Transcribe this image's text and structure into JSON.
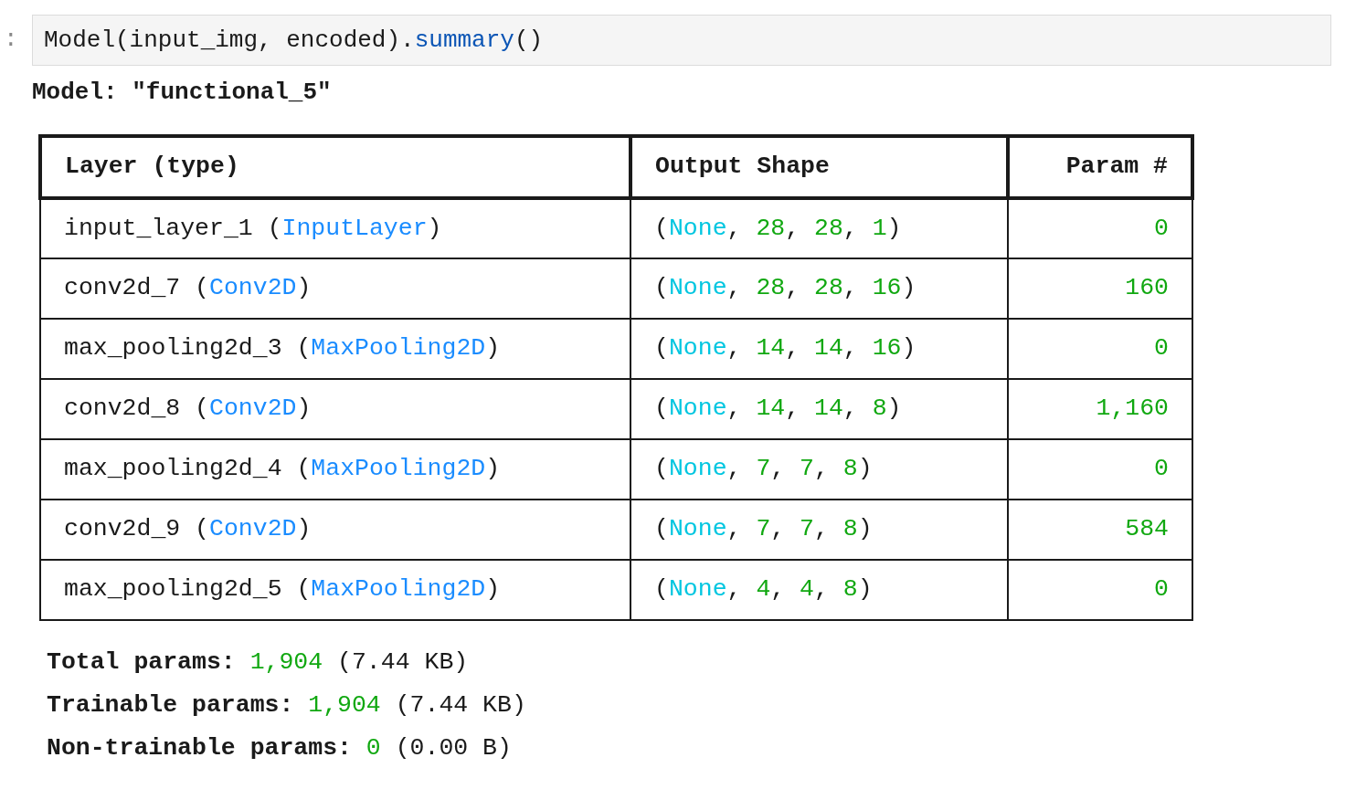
{
  "cell": {
    "prompt": ":",
    "code": [
      {
        "kind": "plain",
        "text": "Model(input_img, encoded)."
      },
      {
        "kind": "method",
        "text": "summary"
      },
      {
        "kind": "plain",
        "text": "()"
      }
    ]
  },
  "output": {
    "model_title": "Model: \"functional_5\"",
    "table": {
      "columns": [
        {
          "label": "Layer (type)",
          "kind": "text"
        },
        {
          "label": "Output Shape",
          "kind": "text"
        },
        {
          "label": "Param #",
          "kind": "number"
        }
      ],
      "rows": [
        {
          "layer": [
            {
              "kind": "plain",
              "text": "input_layer_1 ("
            },
            {
              "kind": "type",
              "text": "InputLayer"
            },
            {
              "kind": "plain",
              "text": ")"
            }
          ],
          "shape": [
            {
              "kind": "plain",
              "text": "("
            },
            {
              "kind": "none",
              "text": "None"
            },
            {
              "kind": "plain",
              "text": ", "
            },
            {
              "kind": "num",
              "text": "28"
            },
            {
              "kind": "plain",
              "text": ", "
            },
            {
              "kind": "num",
              "text": "28"
            },
            {
              "kind": "plain",
              "text": ", "
            },
            {
              "kind": "num",
              "text": "1"
            },
            {
              "kind": "plain",
              "text": ")"
            }
          ],
          "params": "0"
        },
        {
          "layer": [
            {
              "kind": "plain",
              "text": "conv2d_7 ("
            },
            {
              "kind": "type",
              "text": "Conv2D"
            },
            {
              "kind": "plain",
              "text": ")"
            }
          ],
          "shape": [
            {
              "kind": "plain",
              "text": "("
            },
            {
              "kind": "none",
              "text": "None"
            },
            {
              "kind": "plain",
              "text": ", "
            },
            {
              "kind": "num",
              "text": "28"
            },
            {
              "kind": "plain",
              "text": ", "
            },
            {
              "kind": "num",
              "text": "28"
            },
            {
              "kind": "plain",
              "text": ", "
            },
            {
              "kind": "num",
              "text": "16"
            },
            {
              "kind": "plain",
              "text": ")"
            }
          ],
          "params": "160"
        },
        {
          "layer": [
            {
              "kind": "plain",
              "text": "max_pooling2d_3 ("
            },
            {
              "kind": "type",
              "text": "MaxPooling2D"
            },
            {
              "kind": "plain",
              "text": ")"
            }
          ],
          "shape": [
            {
              "kind": "plain",
              "text": "("
            },
            {
              "kind": "none",
              "text": "None"
            },
            {
              "kind": "plain",
              "text": ", "
            },
            {
              "kind": "num",
              "text": "14"
            },
            {
              "kind": "plain",
              "text": ", "
            },
            {
              "kind": "num",
              "text": "14"
            },
            {
              "kind": "plain",
              "text": ", "
            },
            {
              "kind": "num",
              "text": "16"
            },
            {
              "kind": "plain",
              "text": ")"
            }
          ],
          "params": "0"
        },
        {
          "layer": [
            {
              "kind": "plain",
              "text": "conv2d_8 ("
            },
            {
              "kind": "type",
              "text": "Conv2D"
            },
            {
              "kind": "plain",
              "text": ")"
            }
          ],
          "shape": [
            {
              "kind": "plain",
              "text": "("
            },
            {
              "kind": "none",
              "text": "None"
            },
            {
              "kind": "plain",
              "text": ", "
            },
            {
              "kind": "num",
              "text": "14"
            },
            {
              "kind": "plain",
              "text": ", "
            },
            {
              "kind": "num",
              "text": "14"
            },
            {
              "kind": "plain",
              "text": ", "
            },
            {
              "kind": "num",
              "text": "8"
            },
            {
              "kind": "plain",
              "text": ")"
            }
          ],
          "params": "1,160"
        },
        {
          "layer": [
            {
              "kind": "plain",
              "text": "max_pooling2d_4 ("
            },
            {
              "kind": "type",
              "text": "MaxPooling2D"
            },
            {
              "kind": "plain",
              "text": ")"
            }
          ],
          "shape": [
            {
              "kind": "plain",
              "text": "("
            },
            {
              "kind": "none",
              "text": "None"
            },
            {
              "kind": "plain",
              "text": ", "
            },
            {
              "kind": "num",
              "text": "7"
            },
            {
              "kind": "plain",
              "text": ", "
            },
            {
              "kind": "num",
              "text": "7"
            },
            {
              "kind": "plain",
              "text": ", "
            },
            {
              "kind": "num",
              "text": "8"
            },
            {
              "kind": "plain",
              "text": ")"
            }
          ],
          "params": "0"
        },
        {
          "layer": [
            {
              "kind": "plain",
              "text": "conv2d_9 ("
            },
            {
              "kind": "type",
              "text": "Conv2D"
            },
            {
              "kind": "plain",
              "text": ")"
            }
          ],
          "shape": [
            {
              "kind": "plain",
              "text": "("
            },
            {
              "kind": "none",
              "text": "None"
            },
            {
              "kind": "plain",
              "text": ", "
            },
            {
              "kind": "num",
              "text": "7"
            },
            {
              "kind": "plain",
              "text": ", "
            },
            {
              "kind": "num",
              "text": "7"
            },
            {
              "kind": "plain",
              "text": ", "
            },
            {
              "kind": "num",
              "text": "8"
            },
            {
              "kind": "plain",
              "text": ")"
            }
          ],
          "params": "584"
        },
        {
          "layer": [
            {
              "kind": "plain",
              "text": "max_pooling2d_5 ("
            },
            {
              "kind": "type",
              "text": "MaxPooling2D"
            },
            {
              "kind": "plain",
              "text": ")"
            }
          ],
          "shape": [
            {
              "kind": "plain",
              "text": "("
            },
            {
              "kind": "none",
              "text": "None"
            },
            {
              "kind": "plain",
              "text": ", "
            },
            {
              "kind": "num",
              "text": "4"
            },
            {
              "kind": "plain",
              "text": ", "
            },
            {
              "kind": "num",
              "text": "4"
            },
            {
              "kind": "plain",
              "text": ", "
            },
            {
              "kind": "num",
              "text": "8"
            },
            {
              "kind": "plain",
              "text": ")"
            }
          ],
          "params": "0"
        }
      ]
    },
    "totals": [
      [
        {
          "kind": "label",
          "text": "Total params: "
        },
        {
          "kind": "num",
          "text": "1,904"
        },
        {
          "kind": "plain",
          "text": " (7.44 KB)"
        }
      ],
      [
        {
          "kind": "label",
          "text": "Trainable params: "
        },
        {
          "kind": "num",
          "text": "1,904"
        },
        {
          "kind": "plain",
          "text": " (7.44 KB)"
        }
      ],
      [
        {
          "kind": "label",
          "text": "Non-trainable params: "
        },
        {
          "kind": "num",
          "text": "0"
        },
        {
          "kind": "plain",
          "text": " (0.00 B)"
        }
      ]
    ]
  }
}
